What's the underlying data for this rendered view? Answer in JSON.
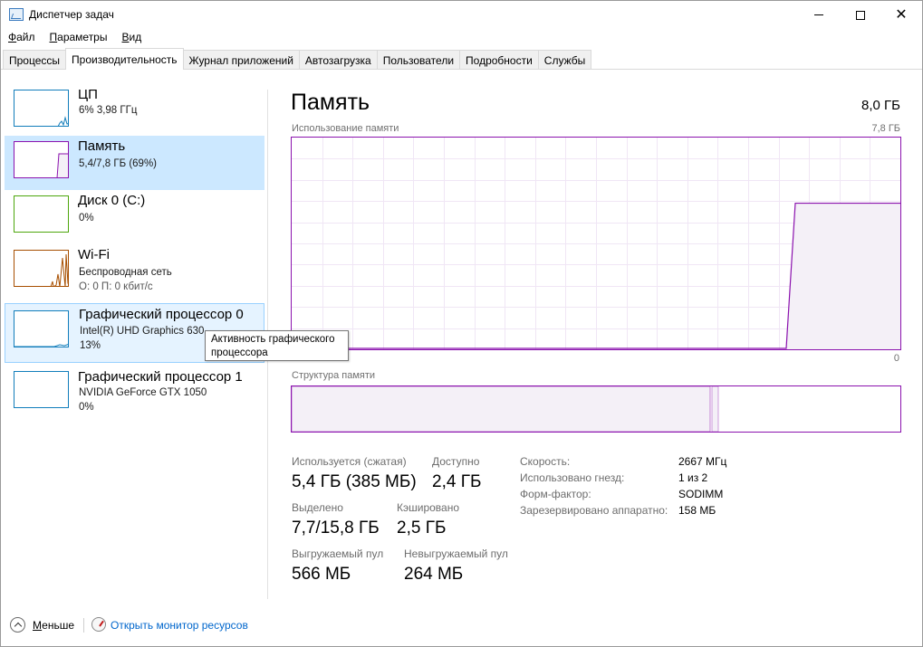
{
  "window": {
    "title": "Диспетчер задач",
    "minimize_glyph": "",
    "close_glyph": "✕"
  },
  "menu": [
    {
      "key": "Ф",
      "rest": "айл"
    },
    {
      "key": "П",
      "rest": "араметры"
    },
    {
      "key": "В",
      "rest": "ид"
    }
  ],
  "tabs": [
    {
      "label": "Процессы",
      "active": false
    },
    {
      "label": "Производительность",
      "active": true
    },
    {
      "label": "Журнал приложений",
      "active": false
    },
    {
      "label": "Автозагрузка",
      "active": false
    },
    {
      "label": "Пользователи",
      "active": false
    },
    {
      "label": "Подробности",
      "active": false
    },
    {
      "label": "Службы",
      "active": false
    }
  ],
  "sidebar": {
    "items": [
      {
        "name": "ЦП",
        "line1": "6% 3,98 ГГц",
        "line2": "",
        "color": "#117dbb",
        "utilization": 0.06
      },
      {
        "name": "Память",
        "line1": "5,4/7,8 ГБ (69%)",
        "line2": "",
        "color": "#8b12ae",
        "utilization": 0.69
      },
      {
        "name": "Диск 0 (C:)",
        "line1": "0%",
        "line2": "",
        "color": "#4da60c",
        "utilization": 0.0
      },
      {
        "name": "Wi-Fi",
        "line1": "Беспроводная сеть",
        "line2": "О: 0 П: 0 кбит/с",
        "color": "#a74f01",
        "utilization": 0.0
      },
      {
        "name": "Графический процессор 0",
        "line1": "Intel(R) UHD Graphics 630",
        "line2": "13%",
        "color": "#117dbb",
        "utilization": 0.13
      },
      {
        "name": "Графический процессор 1",
        "line1": "NVIDIA GeForce GTX 1050",
        "line2": "0%",
        "color": "#117dbb",
        "utilization": 0.0
      }
    ]
  },
  "tooltip": {
    "line1": "Активность графического",
    "line2": "процессора"
  },
  "main": {
    "title": "Память",
    "total": "8,0 ГБ",
    "usage_chart": {
      "label": "Использование памяти",
      "max_label": "7,8 ГБ",
      "min_label": "0",
      "line_color": "#8b12ae",
      "fill_color": "#f4f0f7",
      "grid_color": "#f0e6f5",
      "used_fraction": 0.69
    },
    "structure_chart": {
      "label": "Структура памяти",
      "in_use_fraction": 0.687,
      "modified_fraction": 0.01
    },
    "stats": {
      "in_use_label": "Используется (сжатая)",
      "in_use_value": "5,4 ГБ (385 МБ)",
      "available_label": "Доступно",
      "available_value": "2,4 ГБ",
      "committed_label": "Выделено",
      "committed_value": "7,7/15,8 ГБ",
      "cached_label": "Кэшировано",
      "cached_value": "2,5 ГБ",
      "paged_label": "Выгружаемый пул",
      "paged_value": "566 МБ",
      "nonpaged_label": "Невыгружаемый пул",
      "nonpaged_value": "264 МБ"
    },
    "properties": [
      {
        "label": "Скорость:",
        "value": "2667 МГц"
      },
      {
        "label": "Использовано гнезд:",
        "value": "1 из 2"
      },
      {
        "label": "Форм-фактор:",
        "value": "SODIMM"
      },
      {
        "label": "Зарезервировано аппаратно:",
        "value": "158 МБ"
      }
    ]
  },
  "bottom": {
    "less_key": "М",
    "less_rest": "еньше",
    "monitor_link": "Открыть монитор ресурсов"
  }
}
